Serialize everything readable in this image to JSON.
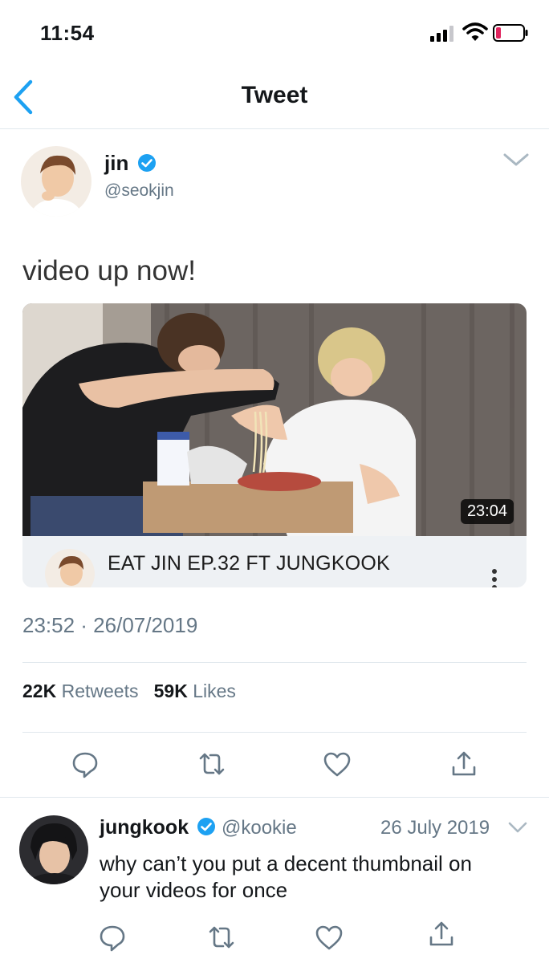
{
  "status_bar": {
    "time": "11:54"
  },
  "nav": {
    "title": "Tweet"
  },
  "tweet": {
    "author_name": "jin",
    "author_handle": "@seokjin",
    "text": "video up now!",
    "media": {
      "duration": "23:04",
      "card_title": "EAT JIN EP.32 FT JUNGKOOK"
    },
    "timestamp": "23:52 · 26/07/2019",
    "retweets_count": "22K",
    "retweets_label": "Retweets",
    "likes_count": "59K",
    "likes_label": "Likes"
  },
  "reply": {
    "author_name": "jungkook",
    "author_handle": "@kookie",
    "date": "26 July 2019",
    "text": "why can’t you put a decent thumbnail on your videos for once"
  },
  "icons": {
    "back": "chevron-left-icon",
    "verified": "verified-badge-icon",
    "more": "chevron-down-icon",
    "reply": "comment-bubble-icon",
    "retweet": "retweet-icon",
    "like": "heart-icon",
    "share": "share-icon"
  },
  "colors": {
    "accent": "#1da1f2",
    "secondary_text": "#657786",
    "divider": "#e1e8ed",
    "battery_low": "#e0245e"
  }
}
